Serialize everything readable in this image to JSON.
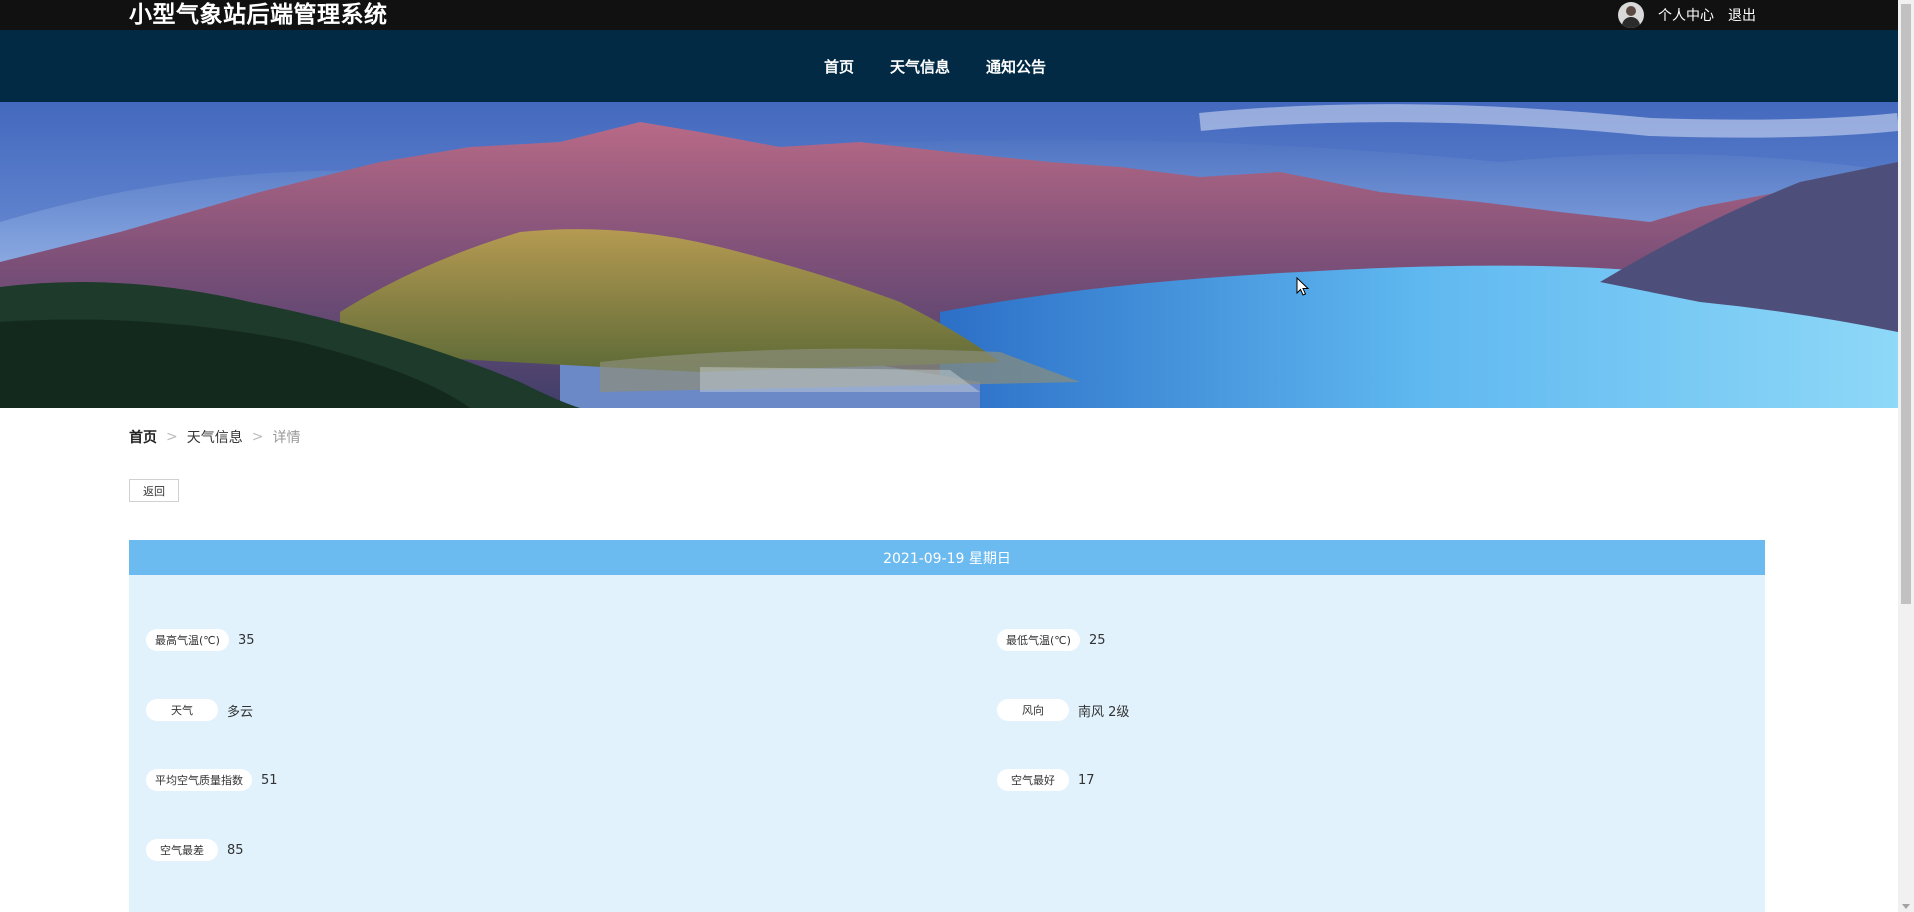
{
  "header": {
    "title": "小型气象站后端管理系统",
    "user_links": [
      "个人中心",
      "退出"
    ]
  },
  "nav": {
    "items": [
      "首页",
      "天气信息",
      "通知公告"
    ]
  },
  "breadcrumb": {
    "items": [
      "首页",
      "天气信息",
      "详情"
    ],
    "separator": ">"
  },
  "back_button": "返回",
  "detail": {
    "date_header": "2021-09-19 星期日",
    "fields": [
      {
        "label": "最高气温(℃)",
        "value": "35"
      },
      {
        "label": "最低气温(℃)",
        "value": "25"
      },
      {
        "label": "天气",
        "value": "多云"
      },
      {
        "label": "风向",
        "value": "南风 2级"
      },
      {
        "label": "平均空气质量指数",
        "value": "51"
      },
      {
        "label": "空气最好",
        "value": "17"
      },
      {
        "label": "空气最差",
        "value": "85"
      }
    ]
  },
  "colors": {
    "topbar": "#111111",
    "navbar": "#022a45",
    "detail_header": "#6bbaf0",
    "detail_body": "#e1f2fd",
    "carousel_dot": "#e8433a"
  },
  "icons": [
    "avatar",
    "carousel-dot",
    "mouse-cursor-icon"
  ]
}
